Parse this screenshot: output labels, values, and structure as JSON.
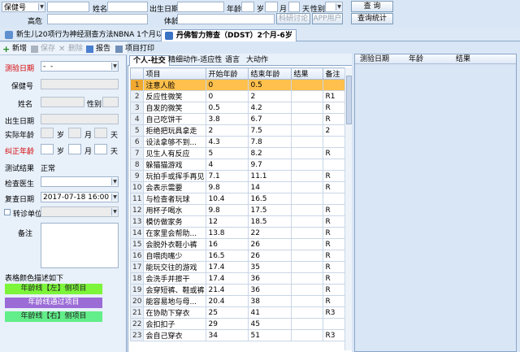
{
  "search": {
    "field_select": "保健号",
    "name_label": "姓名",
    "birthdate_label": "出生日期",
    "age_label": "年龄",
    "year_unit": "岁",
    "month_unit": "月",
    "day_unit": "天",
    "sex_label": "性别",
    "height_label": "高危",
    "exam_label": "体龄",
    "query_button": "查 询",
    "stats_button": "查询统计",
    "btn_a": "科研讨论",
    "btn_b": "APP用户"
  },
  "tabs": [
    {
      "label": "新生儿20项行为神经测查方法NBNA 1个月以内"
    },
    {
      "label": "丹佛智力筛查（DDST）2个月-6岁"
    }
  ],
  "toolbar": {
    "add": "新增",
    "save": "保存",
    "delete": "删除",
    "report": "报告",
    "print": "项目打印"
  },
  "form": {
    "test_date_label": "测验日期",
    "test_date_value": "-  -",
    "health_no_label": "保健号",
    "name_label": "姓名",
    "sex_label": "性别",
    "birth_label": "出生日期",
    "actual_age_label": "实际年龄",
    "corrected_age_label": "纠正年龄",
    "year_unit": "岁",
    "month_unit": "月",
    "day_unit": "天",
    "result_label": "测试结果",
    "result_value": "正常",
    "doctor_label": "检查医生",
    "recheck_label": "复查日期",
    "recheck_value": "2017-07-18 16:00",
    "transfer_label": "转诊单位",
    "remark_label": "备注",
    "legend_title": "表格颜色描述如下",
    "legend": [
      {
        "label": "年龄线【左】侧项目",
        "color": "#7cf53a"
      },
      {
        "label": "年龄线通过项目",
        "color": "#9b6bd6"
      },
      {
        "label": "年龄线【右】侧项目",
        "color": "#62ee8a"
      }
    ]
  },
  "subtabs": [
    "个人-社交",
    "精细动作-适应性",
    "语言",
    "大动作"
  ],
  "grid": {
    "columns": [
      "项目",
      "开始年龄",
      "结束年龄",
      "结果",
      "备注"
    ],
    "rows": [
      [
        "注意人脸",
        "0",
        "0.5",
        "",
        ""
      ],
      [
        "反应性微笑",
        "0",
        "2",
        "",
        "R1"
      ],
      [
        "自发的微笑",
        "0.5",
        "4.2",
        "",
        "R"
      ],
      [
        "自己吃饼干",
        "3.8",
        "6.7",
        "",
        "R"
      ],
      [
        "拒绝把玩具拿走",
        "2",
        "7.5",
        "",
        "2"
      ],
      [
        "设法拿够不到...",
        "4.3",
        "7.8",
        "",
        ""
      ],
      [
        "见生人有反应",
        "5",
        "8.2",
        "",
        "R"
      ],
      [
        "躲猫猫游戏",
        "4",
        "9.7",
        "",
        ""
      ],
      [
        "玩拍手或挥手再见",
        "7.1",
        "11.1",
        "",
        "R"
      ],
      [
        "会表示需要",
        "9.8",
        "14",
        "",
        "R"
      ],
      [
        "与检查者玩球",
        "10.4",
        "16.5",
        "",
        ""
      ],
      [
        "用杯子喝水",
        "9.8",
        "17.5",
        "",
        "R"
      ],
      [
        "模仿做家务",
        "12",
        "18.5",
        "",
        "R"
      ],
      [
        "在家里会帮助...",
        "13.8",
        "22",
        "",
        "R"
      ],
      [
        "会脱外衣鞋小裤",
        "16",
        "26",
        "",
        "R"
      ],
      [
        "自喂肉嘴少",
        "16.5",
        "26",
        "",
        "R"
      ],
      [
        "能玩交往的游戏",
        "17.4",
        "35",
        "",
        "R"
      ],
      [
        "会洗手并擦干",
        "17.4",
        "36",
        "",
        "R"
      ],
      [
        "会穿短裤、鞋或裤",
        "21.4",
        "36",
        "",
        "R"
      ],
      [
        "能容易地与母...",
        "20.4",
        "38",
        "",
        "R"
      ],
      [
        "在协助下穿衣",
        "25",
        "41",
        "",
        "R3"
      ],
      [
        "会扣扣子",
        "29",
        "45",
        "",
        ""
      ],
      [
        "会自己穿衣",
        "34",
        "51",
        "",
        "R3"
      ]
    ]
  },
  "right_panel": {
    "columns": [
      "测验日期",
      "年龄",
      "结果"
    ]
  },
  "colors": {
    "selected_row": "#ffc04d",
    "required_label": "#d40000"
  }
}
